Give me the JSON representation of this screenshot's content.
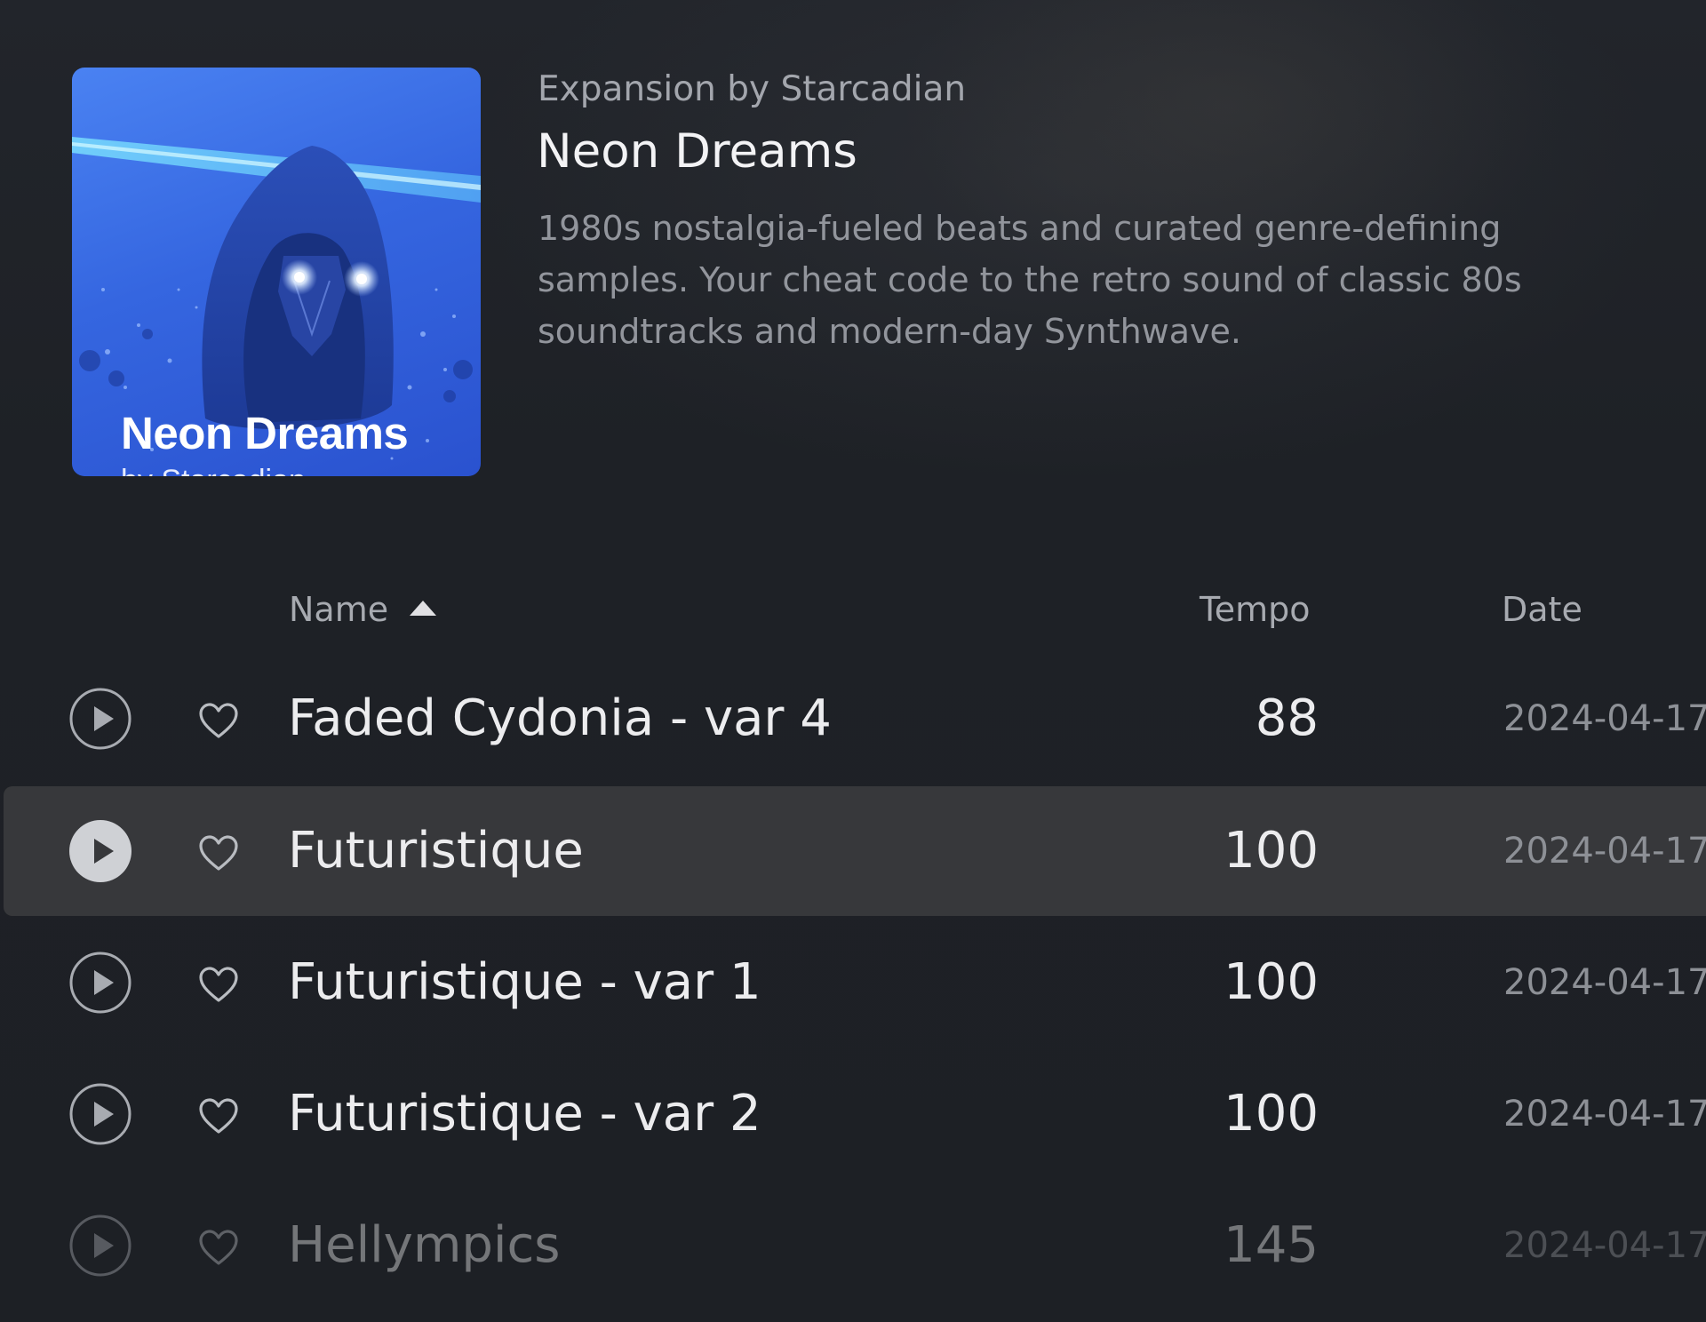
{
  "expansion": {
    "overline": "Expansion by Starcadian",
    "title": "Neon Dreams",
    "description": "1980s nostalgia-fueled beats and curated genre-defining samples. Your cheat code to the retro sound of classic 80s soundtracks and modern-day Synthwave.",
    "cover": {
      "title": "Neon Dreams",
      "subtitle": "by Starcadian",
      "accent_color": "#3a6ce6"
    }
  },
  "table": {
    "columns": {
      "name": "Name",
      "tempo": "Tempo",
      "date": "Date"
    },
    "sort": {
      "column": "name",
      "direction": "ascending",
      "icon": "sort-ascending-icon"
    },
    "rows": [
      {
        "name": "Faded Cydonia - var 4",
        "tempo": "88",
        "date": "2024-04-17",
        "selected": false
      },
      {
        "name": "Futuristique",
        "tempo": "100",
        "date": "2024-04-17",
        "selected": true
      },
      {
        "name": "Futuristique - var 1",
        "tempo": "100",
        "date": "2024-04-17",
        "selected": false
      },
      {
        "name": "Futuristique - var 2",
        "tempo": "100",
        "date": "2024-04-17",
        "selected": false
      },
      {
        "name": "Hellympics",
        "tempo": "145",
        "date": "2024-04-17",
        "selected": false
      }
    ]
  },
  "icons": {
    "play": "play-icon",
    "favorite": "heart-icon"
  },
  "colors": {
    "background": "#1e2126",
    "selected_row": "#37383b",
    "text_primary": "#ececee",
    "text_secondary": "#92959c"
  }
}
